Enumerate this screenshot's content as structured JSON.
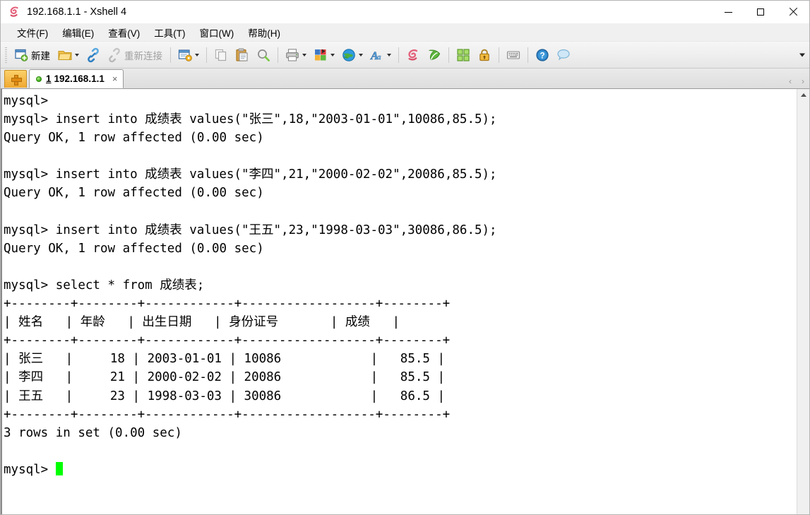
{
  "window": {
    "title": "192.168.1.1 - Xshell 4",
    "logo_icon": "xshell-logo-icon",
    "minimize_label": "—",
    "maximize_label": "□",
    "close_label": "✕"
  },
  "menubar": {
    "items": [
      {
        "label": "文件(F)",
        "name": "menu-file"
      },
      {
        "label": "编辑(E)",
        "name": "menu-edit"
      },
      {
        "label": "查看(V)",
        "name": "menu-view"
      },
      {
        "label": "工具(T)",
        "name": "menu-tools"
      },
      {
        "label": "窗口(W)",
        "name": "menu-window"
      },
      {
        "label": "帮助(H)",
        "name": "menu-help"
      }
    ]
  },
  "toolbar": {
    "new_label": "新建",
    "reconnect_label": "重新连接",
    "icons": {
      "new": "new-session-icon",
      "open": "open-folder-icon",
      "connect": "connect-link-icon",
      "disconnect": "disconnect-link-icon",
      "properties": "session-properties-icon",
      "copy": "copy-icon",
      "paste": "paste-icon",
      "find": "find-magnifier-icon",
      "print": "printer-icon",
      "layout": "color-layout-icon",
      "globe": "globe-icon",
      "font": "font-a-icon",
      "xshell": "xshell-logo-icon",
      "xftp": "xftp-logo-icon",
      "arrange": "arrange-windows-icon",
      "lock": "lock-icon",
      "keyboard": "keyboard-icon",
      "help": "help-question-icon",
      "chat": "chat-bubble-icon",
      "overflow": "toolbar-overflow-chevron-icon"
    }
  },
  "tabbar": {
    "new_tab_icon": "new-tab-plus-icon",
    "tabs": [
      {
        "index": "1",
        "title": "192.168.1.1",
        "status": "connected",
        "close_label": "×"
      }
    ],
    "nav_prev": "‹",
    "nav_next": "›"
  },
  "terminal": {
    "prompt": "mysql>",
    "cursor_color": "#00ff00",
    "background": "#ffffff",
    "foreground": "#000000",
    "lines": [
      "mysql>",
      "mysql> insert into 成绩表 values(\"张三\",18,\"2003-01-01\",10086,85.5);",
      "Query OK, 1 row affected (0.00 sec)",
      "",
      "mysql> insert into 成绩表 values(\"李四\",21,\"2000-02-02\",20086,85.5);",
      "Query OK, 1 row affected (0.00 sec)",
      "",
      "mysql> insert into 成绩表 values(\"王五\",23,\"1998-03-03\",30086,86.5);",
      "Query OK, 1 row affected (0.00 sec)",
      "",
      "mysql> select * from 成绩表;",
      "+--------+--------+------------+------------------+--------+",
      "| 姓名   | 年龄   | 出生日期   | 身份证号       | 成绩   |",
      "+--------+--------+------------+------------------+--------+",
      "| 张三   |     18 | 2003-01-01 | 10086            |   85.5 |",
      "| 李四   |     21 | 2000-02-02 | 20086            |   85.5 |",
      "| 王五   |     23 | 1998-03-03 | 30086            |   86.5 |",
      "+--------+--------+------------+------------------+--------+",
      "3 rows in set (0.00 sec)",
      ""
    ],
    "last_line_prefix": "mysql> ",
    "result_table": {
      "columns": [
        "姓名",
        "年龄",
        "出生日期",
        "身份证号",
        "成绩"
      ],
      "rows": [
        [
          "张三",
          "18",
          "2003-01-01",
          "10086",
          "85.5"
        ],
        [
          "李四",
          "21",
          "2000-02-02",
          "20086",
          "85.5"
        ],
        [
          "王五",
          "23",
          "1998-03-03",
          "30086",
          "86.5"
        ]
      ],
      "row_count_text": "3 rows in set (0.00 sec)",
      "table_name": "成绩表"
    }
  },
  "scrollbar": {
    "up_arrow": "scroll-up-arrow-icon"
  }
}
